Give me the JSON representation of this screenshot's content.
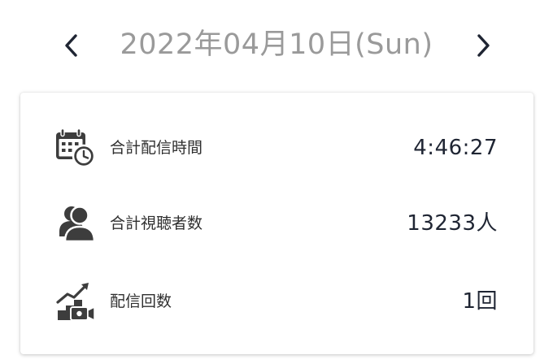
{
  "date_nav": {
    "date_label": "2022年04月10日(Sun)",
    "prev_icon": "chevron-left-icon",
    "next_icon": "chevron-right-icon"
  },
  "stats": [
    {
      "icon": "calendar-clock-icon",
      "label": "合計配信時間",
      "value": "4:46:27"
    },
    {
      "icon": "users-icon",
      "label": "合計視聴者数",
      "value": "13233人"
    },
    {
      "icon": "growth-video-icon",
      "label": "配信回数",
      "value": "1回"
    }
  ],
  "colors": {
    "icon": "#3d3d3d",
    "nav_arrow": "#1f2533",
    "date_text": "#9a9a9a",
    "value_text": "#1f2533"
  }
}
